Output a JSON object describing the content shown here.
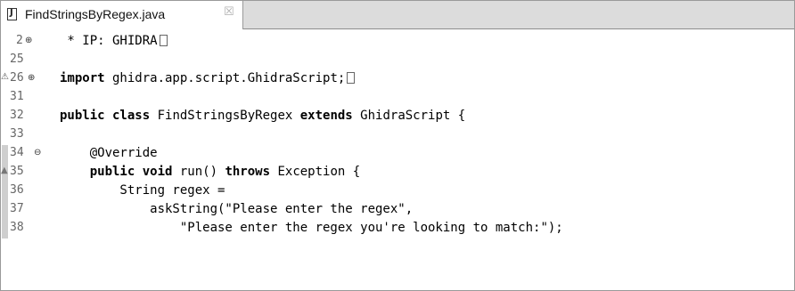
{
  "tab": {
    "title": "FindStringsByRegex.java",
    "close_glyph": "☒"
  },
  "lines": [
    {
      "num": "2",
      "text": " * IP: GHIDRA"
    },
    {
      "num": "25",
      "text": ""
    },
    {
      "num": "26",
      "kw": "import",
      "text": " ghidra.app.script.GhidraScript;"
    },
    {
      "num": "31",
      "text": ""
    },
    {
      "num": "32",
      "kw1": "public class",
      "text1": " FindStringsByRegex ",
      "kw2": "extends",
      "text2": " GhidraScript {"
    },
    {
      "num": "33",
      "text": ""
    },
    {
      "num": "34",
      "text": "    @Override"
    },
    {
      "num": "35",
      "indent": "    ",
      "kw1": "public void",
      "text1": " run() ",
      "kw2": "throws",
      "text2": " Exception {"
    },
    {
      "num": "36",
      "text": "        String regex ="
    },
    {
      "num": "37",
      "text": "            askString(\"Please enter the regex\","
    },
    {
      "num": "38",
      "text": "                \"Please enter the regex you're looking to match:\");"
    }
  ]
}
